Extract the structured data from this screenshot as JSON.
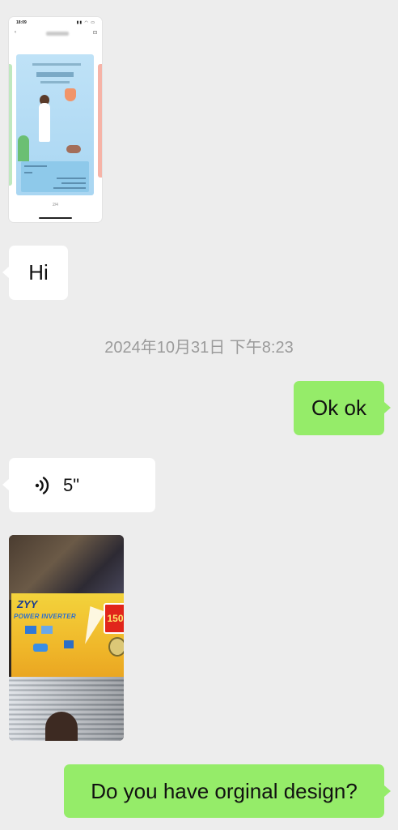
{
  "screenshot_message": {
    "status_time": "18:09",
    "status_icons": "",
    "page_indicator": "2/4"
  },
  "messages": {
    "hi": "Hi",
    "timestamp": "2024年10月31日 下午8:23",
    "ok": "Ok ok",
    "voice_duration": "5\"",
    "design": "Do you have orginal design?"
  },
  "photo": {
    "brand": "ZYY",
    "subtitle": "POWER INVERTER",
    "badge": "150"
  },
  "colors": {
    "background": "#ededed",
    "received_bubble": "#ffffff",
    "sent_bubble": "#95ec69",
    "timestamp_text": "#9b9b9b"
  },
  "icons": {
    "voice": "voice-wave-icon"
  }
}
